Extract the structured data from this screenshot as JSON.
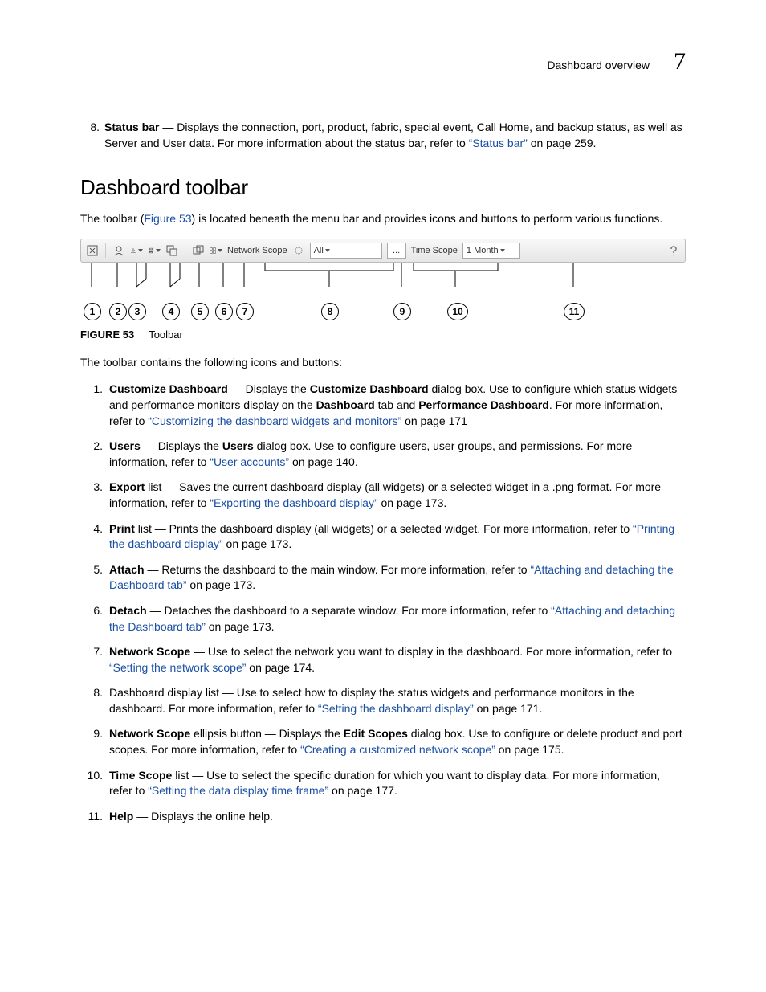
{
  "header": {
    "title": "Dashboard overview",
    "chapter": "7"
  },
  "topItem": {
    "num": "8.",
    "term": "Status bar",
    "text_before": " — Displays the connection, port, product, fabric, special event, Call Home, and backup status, as well as Server and User data. For more information about the status bar, refer to ",
    "link": "“Status bar”",
    "text_after": " on page 259."
  },
  "section": {
    "heading": "Dashboard toolbar",
    "intro_before": "The toolbar (",
    "intro_link": "Figure 53",
    "intro_after": ") is located beneath the menu bar and provides icons and buttons to perform various functions."
  },
  "toolbar": {
    "network_scope_label": "Network Scope",
    "network_scope_value": "All",
    "ellipsis": "...",
    "time_scope_label": "Time Scope",
    "time_scope_value": "1 Month"
  },
  "callout_nums": [
    "1",
    "2",
    "3",
    "4",
    "5",
    "6",
    "7",
    "8",
    "9",
    "10",
    "11"
  ],
  "figure": {
    "label": "FIGURE 53",
    "title": "Toolbar"
  },
  "listIntro": "The toolbar contains the following icons and buttons:",
  "items": [
    {
      "num": "1.",
      "parts": [
        {
          "b": true,
          "t": "Customize Dashboard"
        },
        {
          "b": false,
          "t": " — Displays the "
        },
        {
          "b": true,
          "t": "Customize Dashboard"
        },
        {
          "b": false,
          "t": " dialog box. Use to configure which status widgets and performance monitors display on the "
        },
        {
          "b": true,
          "t": "Dashboard"
        },
        {
          "b": false,
          "t": " tab and "
        },
        {
          "b": true,
          "t": "Performance Dashboard"
        },
        {
          "b": false,
          "t": ". For more information, refer to "
        },
        {
          "link": true,
          "t": "“Customizing the dashboard widgets and monitors”"
        },
        {
          "b": false,
          "t": " on page 171"
        }
      ]
    },
    {
      "num": "2.",
      "parts": [
        {
          "b": true,
          "t": "Users"
        },
        {
          "b": false,
          "t": " — Displays the "
        },
        {
          "b": true,
          "t": "Users"
        },
        {
          "b": false,
          "t": " dialog box. Use to configure users, user groups, and permissions. For more information, refer to "
        },
        {
          "link": true,
          "t": "“User accounts”"
        },
        {
          "b": false,
          "t": " on page 140."
        }
      ]
    },
    {
      "num": "3.",
      "parts": [
        {
          "b": true,
          "t": "Export"
        },
        {
          "b": false,
          "t": " list — Saves the current dashboard display (all widgets) or a selected widget in a .png format. For more information, refer to "
        },
        {
          "link": true,
          "t": "“Exporting the dashboard display”"
        },
        {
          "b": false,
          "t": " on page 173."
        }
      ]
    },
    {
      "num": "4.",
      "parts": [
        {
          "b": true,
          "t": "Print"
        },
        {
          "b": false,
          "t": " list — Prints the dashboard display (all widgets) or a selected widget. For more information, refer to "
        },
        {
          "link": true,
          "t": "“Printing the dashboard display”"
        },
        {
          "b": false,
          "t": " on page 173."
        }
      ]
    },
    {
      "num": "5.",
      "parts": [
        {
          "b": true,
          "t": "Attach"
        },
        {
          "b": false,
          "t": " — Returns the dashboard to the main window. For more information, refer to "
        },
        {
          "link": true,
          "t": "“Attaching and detaching the Dashboard tab”"
        },
        {
          "b": false,
          "t": " on page 173."
        }
      ]
    },
    {
      "num": "6.",
      "parts": [
        {
          "b": true,
          "t": "Detach"
        },
        {
          "b": false,
          "t": " — Detaches the dashboard to a separate window. For more information, refer to "
        },
        {
          "link": true,
          "t": "“Attaching and detaching the Dashboard tab”"
        },
        {
          "b": false,
          "t": " on page 173."
        }
      ]
    },
    {
      "num": "7.",
      "parts": [
        {
          "b": true,
          "t": "Network Scope"
        },
        {
          "b": false,
          "t": " — Use to select the network you want to display in the dashboard. For more information, refer to "
        },
        {
          "link": true,
          "t": "“Setting the network scope”"
        },
        {
          "b": false,
          "t": " on page 174."
        }
      ]
    },
    {
      "num": "8.",
      "parts": [
        {
          "b": false,
          "t": "Dashboard display list — Use to select how to display the status widgets and performance monitors in the dashboard. For more information, refer to "
        },
        {
          "link": true,
          "t": "“Setting the dashboard display”"
        },
        {
          "b": false,
          "t": " on page 171."
        }
      ]
    },
    {
      "num": "9.",
      "parts": [
        {
          "b": true,
          "t": "Network Scope"
        },
        {
          "b": false,
          "t": " ellipsis button — Displays the "
        },
        {
          "b": true,
          "t": "Edit Scopes"
        },
        {
          "b": false,
          "t": " dialog box. Use to configure or delete product and port scopes. For more information, refer to "
        },
        {
          "link": true,
          "t": "“Creating a customized network scope”"
        },
        {
          "b": false,
          "t": " on page 175."
        }
      ]
    },
    {
      "num": "10.",
      "parts": [
        {
          "b": true,
          "t": "Time Scope"
        },
        {
          "b": false,
          "t": " list — Use to select the specific duration for which you want to display data. For more information, refer to "
        },
        {
          "link": true,
          "t": "“Setting the data display time frame”"
        },
        {
          "b": false,
          "t": " on page 177."
        }
      ]
    },
    {
      "num": "11.",
      "parts": [
        {
          "b": true,
          "t": "Help"
        },
        {
          "b": false,
          "t": " — Displays the online help."
        }
      ]
    }
  ]
}
